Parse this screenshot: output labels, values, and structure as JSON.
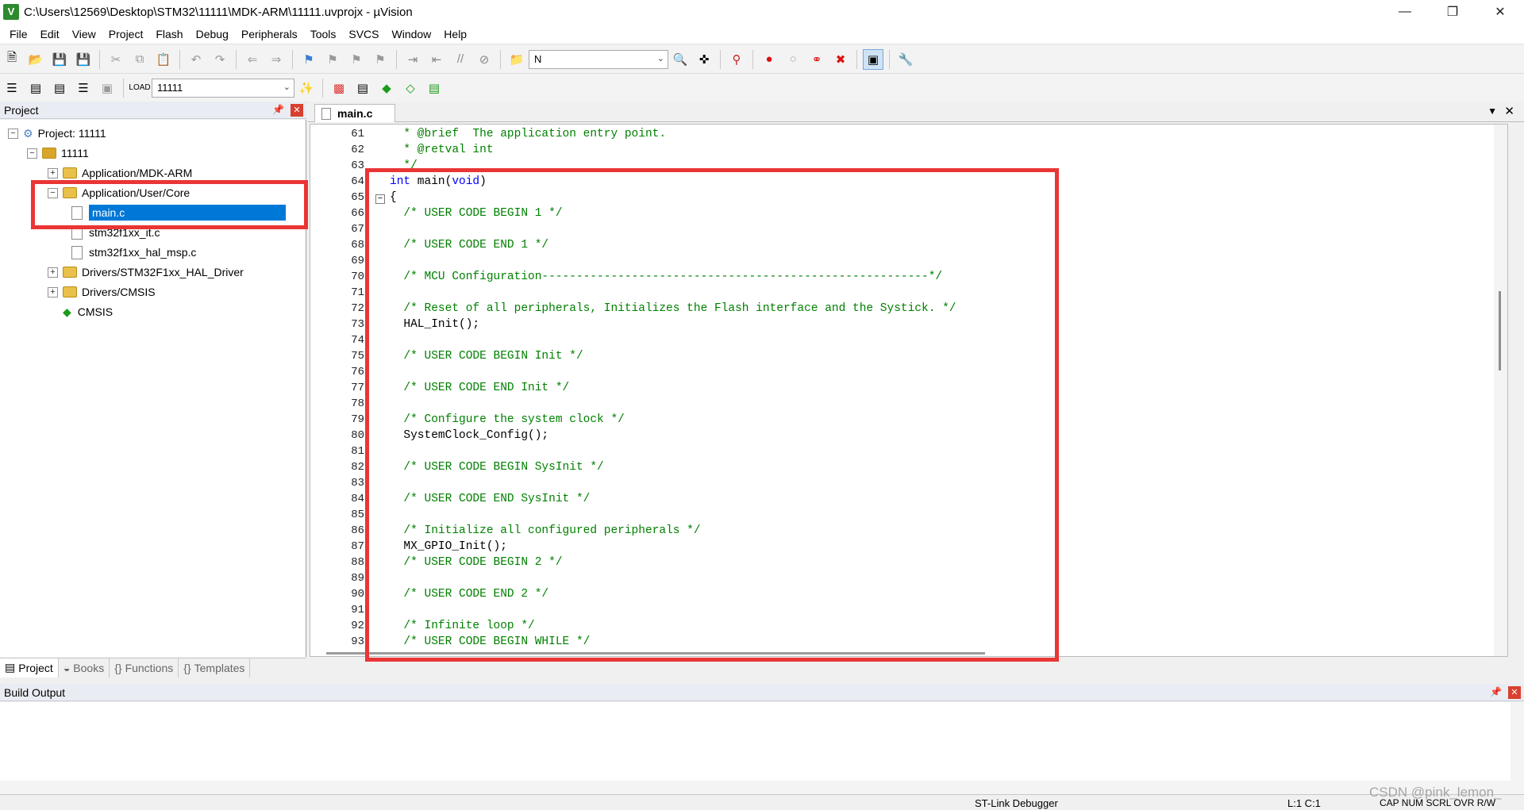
{
  "window": {
    "title": "C:\\Users\\12569\\Desktop\\STM32\\11111\\MDK-ARM\\11111.uvprojx - µVision",
    "app_icon": "V"
  },
  "menu": [
    "File",
    "Edit",
    "View",
    "Project",
    "Flash",
    "Debug",
    "Peripherals",
    "Tools",
    "SVCS",
    "Window",
    "Help"
  ],
  "toolbar1": {
    "find_combo": "N"
  },
  "toolbar2": {
    "target_combo": "11111"
  },
  "project_panel": {
    "title": "Project",
    "tree": [
      {
        "label": "Project: 11111",
        "type": "project",
        "indent": 0,
        "expander": "−"
      },
      {
        "label": "11111",
        "type": "target",
        "indent": 1,
        "expander": "−"
      },
      {
        "label": "Application/MDK-ARM",
        "type": "folder",
        "indent": 2,
        "expander": "+"
      },
      {
        "label": "Application/User/Core",
        "type": "folder",
        "indent": 2,
        "expander": "−"
      },
      {
        "label": "main.c",
        "type": "file",
        "indent": 3,
        "selected": true
      },
      {
        "label": "stm32f1xx_it.c",
        "type": "file",
        "indent": 3
      },
      {
        "label": "stm32f1xx_hal_msp.c",
        "type": "file",
        "indent": 3
      },
      {
        "label": "Drivers/STM32F1xx_HAL_Driver",
        "type": "folder",
        "indent": 2,
        "expander": "+"
      },
      {
        "label": "Drivers/CMSIS",
        "type": "folder",
        "indent": 2,
        "expander": "+"
      },
      {
        "label": "CMSIS",
        "type": "component",
        "indent": 2
      }
    ],
    "tabs": [
      {
        "label": "Project",
        "active": true
      },
      {
        "label": "Books"
      },
      {
        "label": "Functions"
      },
      {
        "label": "Templates"
      }
    ]
  },
  "editor": {
    "tab_label": "main.c",
    "lines": [
      {
        "num": "61",
        "text": "  * @brief  The application entry point.",
        "kind": "cmt"
      },
      {
        "num": "62",
        "text": "  * @retval int",
        "kind": "cmt"
      },
      {
        "num": "63",
        "text": "  */",
        "kind": "cmt"
      },
      {
        "num": "64",
        "text": "int main(void)",
        "kind": "code"
      },
      {
        "num": "65",
        "text": "{",
        "kind": "code"
      },
      {
        "num": "66",
        "text": "  /* USER CODE BEGIN 1 */",
        "kind": "cmt"
      },
      {
        "num": "67",
        "text": "",
        "kind": "code"
      },
      {
        "num": "68",
        "text": "  /* USER CODE END 1 */",
        "kind": "cmt"
      },
      {
        "num": "69",
        "text": "",
        "kind": "code"
      },
      {
        "num": "70",
        "text": "  /* MCU Configuration--------------------------------------------------------*/",
        "kind": "cmt"
      },
      {
        "num": "71",
        "text": "",
        "kind": "code"
      },
      {
        "num": "72",
        "text": "  /* Reset of all peripherals, Initializes the Flash interface and the Systick. */",
        "kind": "cmt"
      },
      {
        "num": "73",
        "text": "  HAL_Init();",
        "kind": "code"
      },
      {
        "num": "74",
        "text": "",
        "kind": "code"
      },
      {
        "num": "75",
        "text": "  /* USER CODE BEGIN Init */",
        "kind": "cmt"
      },
      {
        "num": "76",
        "text": "",
        "kind": "code"
      },
      {
        "num": "77",
        "text": "  /* USER CODE END Init */",
        "kind": "cmt"
      },
      {
        "num": "78",
        "text": "",
        "kind": "code"
      },
      {
        "num": "79",
        "text": "  /* Configure the system clock */",
        "kind": "cmt"
      },
      {
        "num": "80",
        "text": "  SystemClock_Config();",
        "kind": "code"
      },
      {
        "num": "81",
        "text": "",
        "kind": "code"
      },
      {
        "num": "82",
        "text": "  /* USER CODE BEGIN SysInit */",
        "kind": "cmt"
      },
      {
        "num": "83",
        "text": "",
        "kind": "code"
      },
      {
        "num": "84",
        "text": "  /* USER CODE END SysInit */",
        "kind": "cmt"
      },
      {
        "num": "85",
        "text": "",
        "kind": "code"
      },
      {
        "num": "86",
        "text": "  /* Initialize all configured peripherals */",
        "kind": "cmt"
      },
      {
        "num": "87",
        "text": "  MX_GPIO_Init();",
        "kind": "code"
      },
      {
        "num": "88",
        "text": "  /* USER CODE BEGIN 2 */",
        "kind": "cmt"
      },
      {
        "num": "89",
        "text": "",
        "kind": "code"
      },
      {
        "num": "90",
        "text": "  /* USER CODE END 2 */",
        "kind": "cmt"
      },
      {
        "num": "91",
        "text": "",
        "kind": "code"
      },
      {
        "num": "92",
        "text": "  /* Infinite loop */",
        "kind": "cmt"
      },
      {
        "num": "93",
        "text": "  /* USER CODE BEGIN WHILE */",
        "kind": "cmt"
      }
    ]
  },
  "build_output": {
    "title": "Build Output"
  },
  "status_bar": {
    "debugger": "ST-Link Debugger",
    "cursor": "L:1 C:1",
    "indicators": "CAP  NUM  SCRL  OVR  R/W"
  },
  "watermark": "CSDN @pink_lemon_",
  "colors": {
    "highlight_box": "#ea3535",
    "selection": "#0078d7",
    "comment": "#008000",
    "keyword": "#0000ff"
  }
}
